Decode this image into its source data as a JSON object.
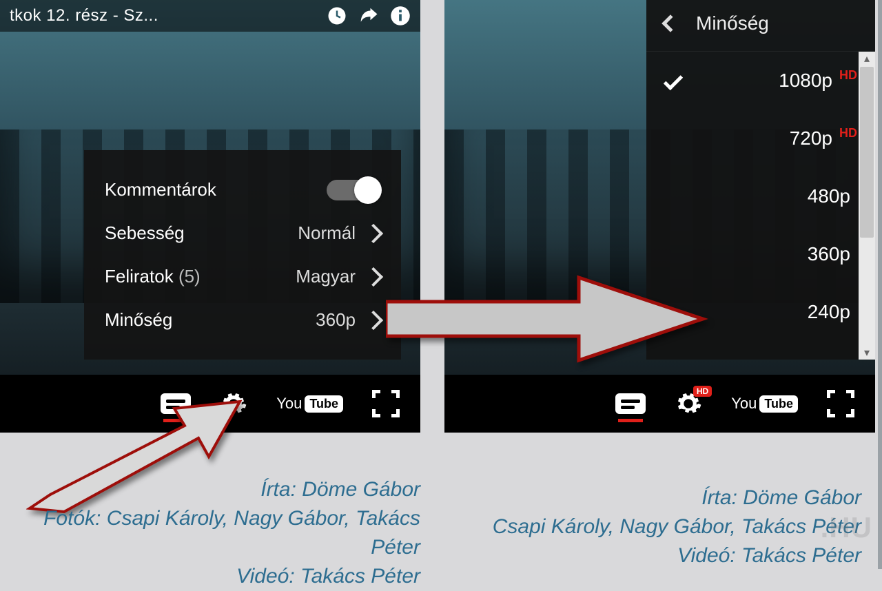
{
  "left": {
    "title": "tkok 12. rész - Sz...",
    "popup": {
      "annotations_label": "Kommentárok",
      "speed_label": "Sebesség",
      "speed_value": "Normál",
      "subs_label": "Feliratok",
      "subs_count": "(5)",
      "subs_value": "Magyar",
      "quality_label": "Minőség",
      "quality_value": "360p"
    },
    "yt": {
      "you": "You",
      "tube": "Tube"
    }
  },
  "right": {
    "quality_header": "Minőség",
    "options": [
      {
        "label": "1080p",
        "hd": "HD",
        "selected": true
      },
      {
        "label": "720p",
        "hd": "HD",
        "selected": false
      },
      {
        "label": "480p",
        "hd": "",
        "selected": false
      },
      {
        "label": "360p",
        "hd": "",
        "selected": false
      },
      {
        "label": "240p",
        "hd": "",
        "selected": false
      }
    ],
    "gear_badge": "HD",
    "yt": {
      "you": "You",
      "tube": "Tube"
    }
  },
  "credits": {
    "line1": "Írta: Döme Gábor",
    "line2": "Fotók: Csapi Károly, Nagy Gábor, Takács Péter",
    "line2b": "Csapi Károly, Nagy Gábor, Takács Péter",
    "line3": "Videó: Takács Péter"
  },
  "watermark": ".HU"
}
